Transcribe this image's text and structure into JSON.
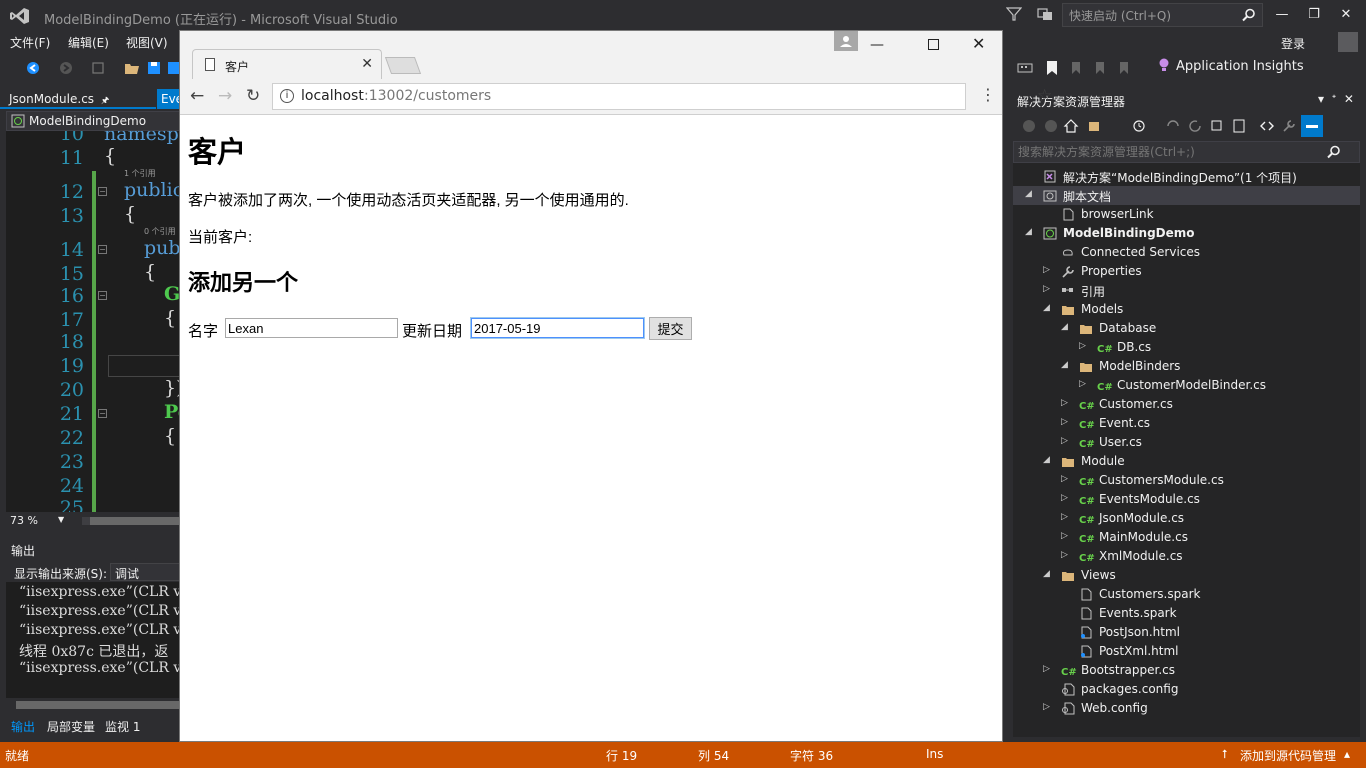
{
  "vs": {
    "title": "ModelBindingDemo (正在运行) - Microsoft Visual Studio",
    "quick_launch_placeholder": "快速启动 (Ctrl+Q)",
    "menu": [
      "文件(F)",
      "编辑(E)",
      "视图(V)"
    ],
    "login": "登录",
    "app_insights": "Application Insights",
    "doc_tab": "JsonModule.cs",
    "doc_tab2": "Eve",
    "nav_bar": "ModelBindingDemo",
    "zoom": "73 %"
  },
  "editor": {
    "lines": [
      {
        "num": "10",
        "code": "namespa"
      },
      {
        "num": "11",
        "code": "{"
      },
      {
        "num": "12",
        "code": "public"
      },
      {
        "num": "13",
        "code": "{"
      },
      {
        "num": "14",
        "code": "pub"
      },
      {
        "num": "15",
        "code": "{"
      },
      {
        "num": "16",
        "code": "G"
      },
      {
        "num": "17",
        "code": "{"
      },
      {
        "num": "18",
        "code": ""
      },
      {
        "num": "19",
        "code": ""
      },
      {
        "num": "20",
        "code": "})"
      },
      {
        "num": "21",
        "code": "Po"
      },
      {
        "num": "22",
        "code": "{"
      },
      {
        "num": "23",
        "code": ""
      },
      {
        "num": "24",
        "code": ""
      },
      {
        "num": "25",
        "code": ""
      }
    ],
    "codelens": [
      "1 个引用",
      "0 个引用"
    ]
  },
  "output": {
    "title": "输出",
    "source_label": "显示输出来源(S):",
    "source_value": "调试",
    "lines": [
      "“iisexpress.exe”(CLR v",
      "“iisexpress.exe”(CLR v",
      "“iisexpress.exe”(CLR v",
      "线程 0x87c 已退出，返",
      "“iisexpress.exe”(CLR v"
    ],
    "tabs": [
      "输出",
      "局部变量",
      "监视 1"
    ]
  },
  "solution_explorer": {
    "title": "解决方案资源管理器",
    "search_placeholder": "搜索解决方案资源管理器(Ctrl+;)",
    "nodes": [
      {
        "label": "解决方案“ModelBindingDemo”(1 个项目)",
        "indent": 0,
        "arrow": "",
        "icon": "solution-icon"
      },
      {
        "label": "脚本文档",
        "indent": 0,
        "arrow": "◢",
        "icon": "script-documents-icon",
        "selected": true
      },
      {
        "label": "browserLink",
        "indent": 1,
        "arrow": "",
        "icon": "file-icon"
      },
      {
        "label": "ModelBindingDemo",
        "indent": 0,
        "arrow": "◢",
        "icon": "web-project-icon",
        "bold": true
      },
      {
        "label": "Connected Services",
        "indent": 1,
        "arrow": "",
        "icon": "connected-services-icon"
      },
      {
        "label": "Properties",
        "indent": 1,
        "arrow": "▷",
        "icon": "wrench-icon"
      },
      {
        "label": "引用",
        "indent": 1,
        "arrow": "▷",
        "icon": "references-icon"
      },
      {
        "label": "Models",
        "indent": 1,
        "arrow": "◢",
        "icon": "folder-icon"
      },
      {
        "label": "Database",
        "indent": 2,
        "arrow": "◢",
        "icon": "folder-icon"
      },
      {
        "label": "DB.cs",
        "indent": 3,
        "arrow": "▷",
        "icon": "csharp-file-icon"
      },
      {
        "label": "ModelBinders",
        "indent": 2,
        "arrow": "◢",
        "icon": "folder-icon"
      },
      {
        "label": "CustomerModelBinder.cs",
        "indent": 3,
        "arrow": "▷",
        "icon": "csharp-file-icon"
      },
      {
        "label": "Customer.cs",
        "indent": 2,
        "arrow": "▷",
        "icon": "csharp-file-icon"
      },
      {
        "label": "Event.cs",
        "indent": 2,
        "arrow": "▷",
        "icon": "csharp-file-icon"
      },
      {
        "label": "User.cs",
        "indent": 2,
        "arrow": "▷",
        "icon": "csharp-file-icon"
      },
      {
        "label": "Module",
        "indent": 1,
        "arrow": "◢",
        "icon": "folder-icon"
      },
      {
        "label": "CustomersModule.cs",
        "indent": 2,
        "arrow": "▷",
        "icon": "csharp-file-icon"
      },
      {
        "label": "EventsModule.cs",
        "indent": 2,
        "arrow": "▷",
        "icon": "csharp-file-icon"
      },
      {
        "label": "JsonModule.cs",
        "indent": 2,
        "arrow": "▷",
        "icon": "csharp-file-icon"
      },
      {
        "label": "MainModule.cs",
        "indent": 2,
        "arrow": "▷",
        "icon": "csharp-file-icon"
      },
      {
        "label": "XmlModule.cs",
        "indent": 2,
        "arrow": "▷",
        "icon": "csharp-file-icon"
      },
      {
        "label": "Views",
        "indent": 1,
        "arrow": "◢",
        "icon": "folder-icon"
      },
      {
        "label": "Customers.spark",
        "indent": 2,
        "arrow": "",
        "icon": "file-icon"
      },
      {
        "label": "Events.spark",
        "indent": 2,
        "arrow": "",
        "icon": "file-icon"
      },
      {
        "label": "PostJson.html",
        "indent": 2,
        "arrow": "",
        "icon": "html-file-icon"
      },
      {
        "label": "PostXml.html",
        "indent": 2,
        "arrow": "",
        "icon": "html-file-icon"
      },
      {
        "label": "Bootstrapper.cs",
        "indent": 1,
        "arrow": "▷",
        "icon": "csharp-file-icon"
      },
      {
        "label": "packages.config",
        "indent": 1,
        "arrow": "",
        "icon": "config-file-icon"
      },
      {
        "label": "Web.config",
        "indent": 1,
        "arrow": "▷",
        "icon": "config-file-icon"
      }
    ]
  },
  "status": {
    "ready": "就绪",
    "line": "行 19",
    "col": "列 54",
    "char": "字符 36",
    "mode": "Ins",
    "source_control": "添加到源代码管理"
  },
  "browser": {
    "tab_title": "客户",
    "url_host": "localhost",
    "url_path": ":13002/customers",
    "page": {
      "heading": "客户",
      "intro": "客户被添加了两次, 一个使用动态活页夹适配器, 另一个使用通用的.",
      "current_label": "当前客户:",
      "add_heading": "添加另一个",
      "name_label": "名字",
      "name_value": "Lexan",
      "date_label": "更新日期",
      "date_value": "2017-05-19",
      "submit_label": "提交"
    }
  },
  "colors": {
    "vs_bg": "#2d2d30",
    "accent": "#007acc",
    "status_debug": "#ca5100",
    "csharp_icon": "#68d14b",
    "folder": "#dcb67a"
  }
}
